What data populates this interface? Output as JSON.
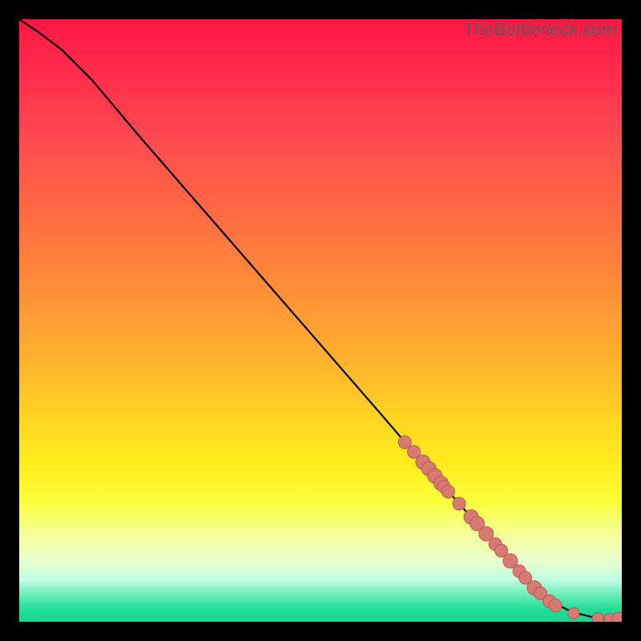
{
  "watermark": "TheBottleneck.com",
  "chart_data": {
    "type": "line",
    "title": "",
    "xlabel": "",
    "ylabel": "",
    "xlim": [
      0,
      100
    ],
    "ylim": [
      0,
      100
    ],
    "background_gradient": {
      "top": "#ff1744",
      "mid": "#ffd422",
      "bottom": "#16d892"
    },
    "curve": {
      "x": [
        0,
        3,
        7,
        12,
        20,
        30,
        40,
        50,
        60,
        66,
        70,
        74,
        78,
        82,
        86,
        89,
        91,
        93,
        95,
        97,
        99,
        100
      ],
      "y": [
        100,
        98,
        95,
        90,
        80.5,
        69,
        57.5,
        46,
        34.5,
        27.5,
        23,
        18.5,
        14,
        9.5,
        5.5,
        3,
        2,
        1.3,
        0.8,
        0.5,
        0.5,
        0.5
      ]
    },
    "data_points": {
      "x": [
        64,
        65.5,
        67,
        68,
        69,
        70,
        70.5,
        71.2,
        73,
        75,
        76,
        77.5,
        79,
        80,
        81.5,
        83,
        84,
        85.5,
        86.5,
        88,
        89,
        92,
        96,
        98,
        99.5
      ],
      "y": [
        29.8,
        28.2,
        26.5,
        25.4,
        24.2,
        23.0,
        22.4,
        21.6,
        19.6,
        17.4,
        16.3,
        14.6,
        12.9,
        11.8,
        10.1,
        8.4,
        7.3,
        5.6,
        4.7,
        3.4,
        2.7,
        1.4,
        0.6,
        0.5,
        0.5
      ],
      "r": [
        8,
        8,
        9,
        9,
        9,
        9,
        8,
        8,
        8,
        9,
        9,
        9,
        8,
        8,
        9,
        8,
        8,
        9,
        8,
        8,
        8,
        7,
        7,
        7,
        8
      ]
    }
  }
}
